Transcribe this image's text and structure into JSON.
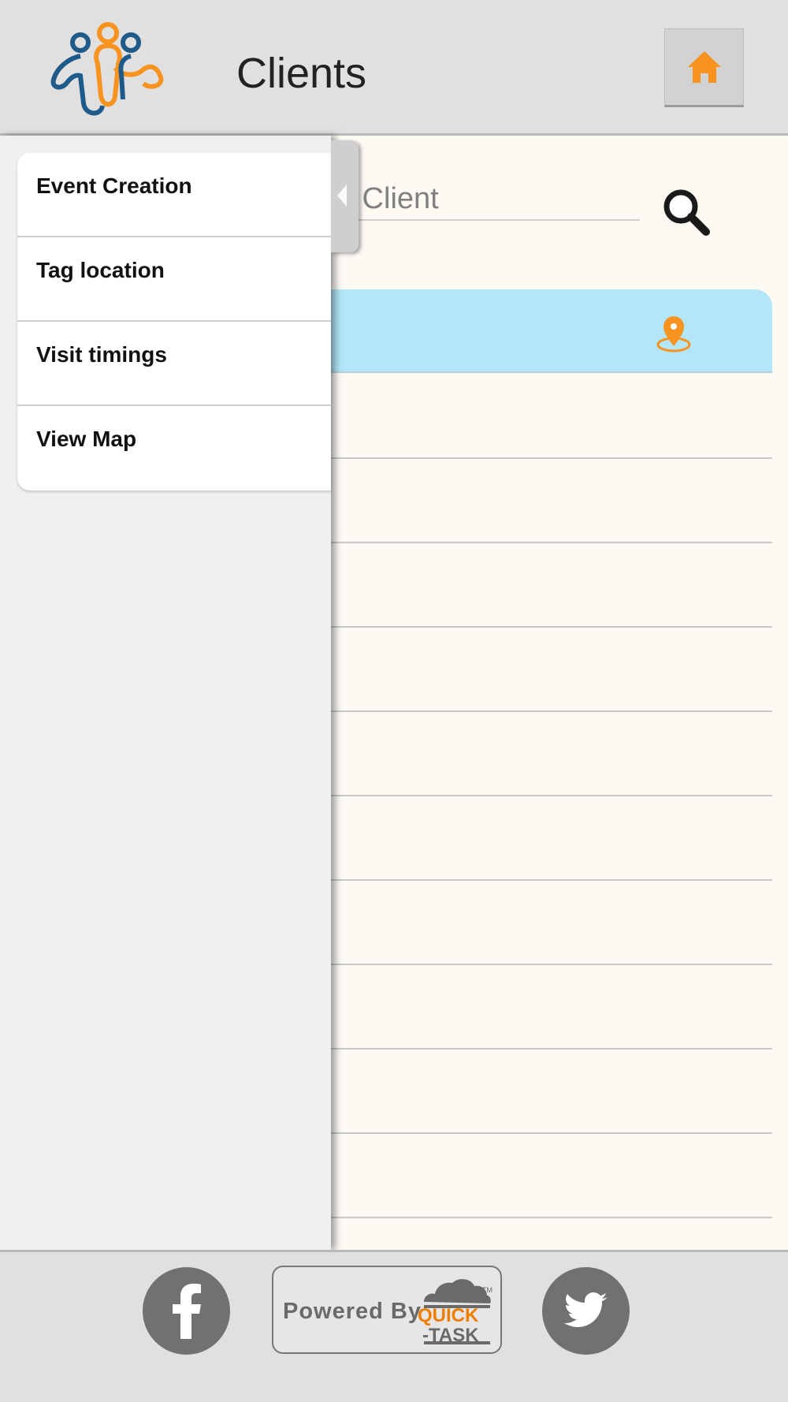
{
  "header": {
    "title": "Clients"
  },
  "search": {
    "placeholder_visible": "y Client"
  },
  "drawer": {
    "items": [
      {
        "label": "Event Creation"
      },
      {
        "label": "Tag location"
      },
      {
        "label": "Visit timings"
      },
      {
        "label": "View Map"
      }
    ]
  },
  "footer": {
    "powered_by": "Powered By",
    "brand_quick": "QUICK",
    "brand_task": "-TASK",
    "brand_tm": "TM"
  },
  "icons": {
    "logo": "people-logo-icon",
    "home": "home-icon",
    "search": "search-icon",
    "pin": "map-pin-icon",
    "facebook": "facebook-icon",
    "twitter": "twitter-icon",
    "drawer_toggle": "chevron-left-icon"
  },
  "colors": {
    "accent_orange": "#f7931e",
    "logo_blue": "#1e5a8a",
    "list_header": "#b2e6f8",
    "header_bg": "#e0e0e0",
    "social_gray": "#717171"
  }
}
